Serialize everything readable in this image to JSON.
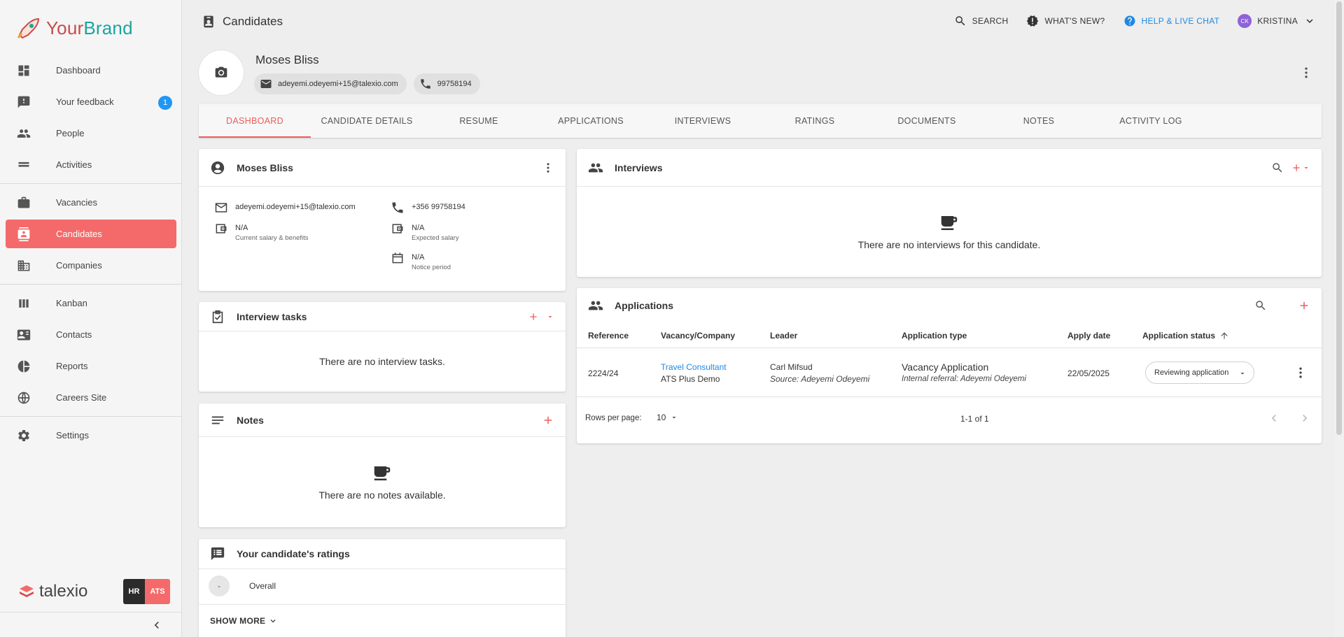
{
  "brand": {
    "name_part1": "Your",
    "name_part2": "Brand"
  },
  "sidebar": {
    "items": [
      {
        "label": "Dashboard"
      },
      {
        "label": "Your feedback",
        "badge": "1"
      },
      {
        "label": "People"
      },
      {
        "label": "Activities"
      },
      {
        "label": "Vacancies"
      },
      {
        "label": "Candidates"
      },
      {
        "label": "Companies"
      },
      {
        "label": "Kanban"
      },
      {
        "label": "Contacts"
      },
      {
        "label": "Reports"
      },
      {
        "label": "Careers Site"
      },
      {
        "label": "Settings"
      }
    ],
    "footer": {
      "logo_text": "talexio",
      "hr": "HR",
      "ats": "ATS"
    }
  },
  "header": {
    "title": "Candidates",
    "search": "SEARCH",
    "whats_new": "WHAT'S NEW?",
    "help": "HELP & LIVE CHAT",
    "user_initials": "CK",
    "user_name": "KRISTINA"
  },
  "profile": {
    "name": "Moses Bliss",
    "email": "adeyemi.odeyemi+15@talexio.com",
    "phone": "99758194"
  },
  "tabs": [
    "DASHBOARD",
    "CANDIDATE DETAILS",
    "RESUME",
    "APPLICATIONS",
    "INTERVIEWS",
    "RATINGS",
    "DOCUMENTS",
    "NOTES",
    "ACTIVITY LOG"
  ],
  "details_card": {
    "title": "Moses Bliss",
    "email": "adeyemi.odeyemi+15@talexio.com",
    "phone": "+356 99758194",
    "current_salary_value": "N/A",
    "current_salary_label": "Current salary & benefits",
    "expected_salary_value": "N/A",
    "expected_salary_label": "Expected salary",
    "notice_value": "N/A",
    "notice_label": "Notice period"
  },
  "interview_tasks": {
    "title": "Interview tasks",
    "empty": "There are no interview tasks."
  },
  "notes": {
    "title": "Notes",
    "empty": "There are no notes available."
  },
  "ratings": {
    "title": "Your candidate's ratings",
    "score": "-",
    "label": "Overall",
    "show_more": "SHOW MORE"
  },
  "interviews": {
    "title": "Interviews",
    "empty": "There are no interviews for this candidate."
  },
  "applications": {
    "title": "Applications",
    "columns": [
      "Reference",
      "Vacancy/Company",
      "Leader",
      "Application type",
      "Apply date",
      "Application status"
    ],
    "rows": [
      {
        "reference": "2224/24",
        "vacancy": "Travel Consultant",
        "company": "ATS Plus Demo",
        "leader": "Carl Mifsud",
        "source": "Source: Adeyemi Odeyemi",
        "type": "Vacancy Application",
        "referral": "Internal referral: Adeyemi Odeyemi",
        "apply_date": "22/05/2025",
        "status": "Reviewing application"
      }
    ],
    "rows_per_page_label": "Rows per page:",
    "rows_per_page": "10",
    "range": "1-1 of 1"
  },
  "colors": {
    "accent": "#f46a6a",
    "link": "#1e88e5",
    "badge": "#2196f3"
  }
}
